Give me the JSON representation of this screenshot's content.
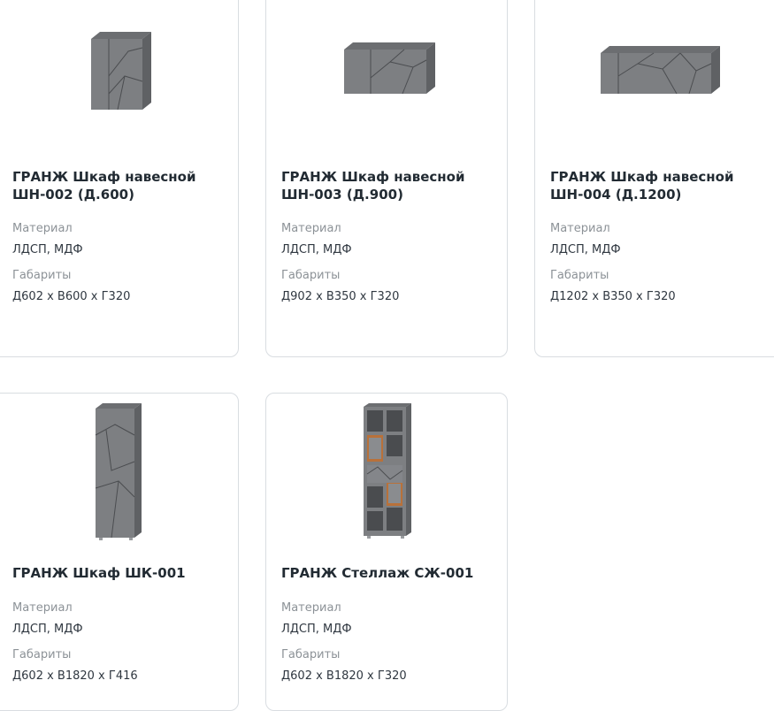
{
  "cards": [
    {
      "title": "ГРАНЖ Шкаф навесной ШН-002 (Д.600)",
      "material_label": "Материал",
      "material": "ЛДСП, МДФ",
      "dims_label": "Габариты",
      "dims": "Д602 х В600 х Г320",
      "image_icon": "wall-cabinet-icon"
    },
    {
      "title": "ГРАНЖ Шкаф навесной ШН-003 (Д.900)",
      "material_label": "Материал",
      "material": "ЛДСП, МДФ",
      "dims_label": "Габариты",
      "dims": "Д902 х В350 х Г320",
      "image_icon": "wall-cabinet-icon"
    },
    {
      "title": "ГРАНЖ Шкаф навесной ШН-004 (Д.1200)",
      "material_label": "Материал",
      "material": "ЛДСП, МДФ",
      "dims_label": "Габариты",
      "dims": "Д1202 х В350 х Г320",
      "image_icon": "wall-cabinet-icon"
    },
    {
      "title": "ГРАНЖ Шкаф ШК-001",
      "material_label": "Материал",
      "material": "ЛДСП, МДФ",
      "dims_label": "Габариты",
      "dims": "Д602 х В1820 х Г416",
      "image_icon": "wardrobe-icon"
    },
    {
      "title": "ГРАНЖ Стеллаж СЖ-001",
      "material_label": "Материал",
      "material": "ЛДСП, МДФ",
      "dims_label": "Габариты",
      "dims": "Д602 х В1820 х Г320",
      "image_icon": "shelving-unit-icon"
    }
  ],
  "colors": {
    "panel": "#7d7f82",
    "panel_dark": "#5f6164",
    "wood": "#b8713a",
    "border": "#d9dde1"
  }
}
